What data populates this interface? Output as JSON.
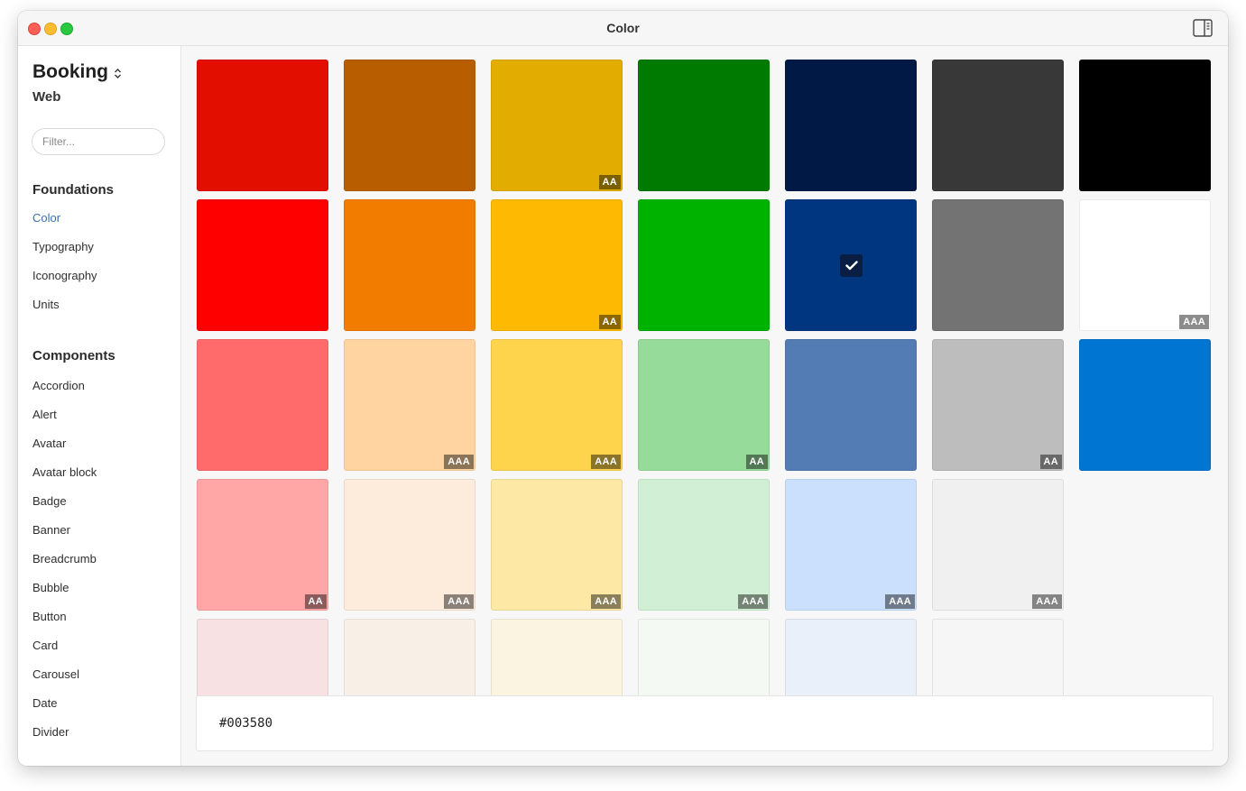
{
  "window": {
    "title": "Color",
    "sidebar_toggle_icon": "sidebar-right-icon"
  },
  "sidebar": {
    "project": "Booking",
    "project_icon": "chevron-up-down-icon",
    "platform": "Web",
    "filter_placeholder": "Filter...",
    "foundations_heading": "Foundations",
    "foundations": [
      "Color",
      "Typography",
      "Iconography",
      "Units"
    ],
    "active_item": "Color",
    "components_heading": "Components",
    "components": [
      "Accordion",
      "Alert",
      "Avatar",
      "Avatar block",
      "Badge",
      "Banner",
      "Breadcrumb",
      "Bubble",
      "Button",
      "Card",
      "Carousel",
      "Date",
      "Divider"
    ]
  },
  "swatches": [
    [
      {
        "color": "#e20e00",
        "badge": ""
      },
      {
        "color": "#b85e00",
        "badge": ""
      },
      {
        "color": "#e2ad00",
        "badge": "AA"
      },
      {
        "color": "#007a00",
        "badge": ""
      },
      {
        "color": "#001a45",
        "badge": ""
      },
      {
        "color": "#383838",
        "badge": ""
      },
      {
        "color": "#000000",
        "badge": ""
      }
    ],
    [
      {
        "color": "#ff0000",
        "badge": ""
      },
      {
        "color": "#f27c00",
        "badge": ""
      },
      {
        "color": "#feba02",
        "badge": "AA"
      },
      {
        "color": "#00b200",
        "badge": ""
      },
      {
        "color": "#003580",
        "badge": "",
        "selected": true
      },
      {
        "color": "#737373",
        "badge": ""
      },
      {
        "color": "#ffffff",
        "badge": "AAA"
      }
    ],
    [
      {
        "color": "#ff6b6b",
        "badge": ""
      },
      {
        "color": "#ffd4a1",
        "badge": "AAA"
      },
      {
        "color": "#fed44c",
        "badge": "AAA"
      },
      {
        "color": "#97db9b",
        "badge": "AA"
      },
      {
        "color": "#537bb4",
        "badge": ""
      },
      {
        "color": "#bdbdbd",
        "badge": "AA"
      },
      {
        "color": "#0075d1",
        "badge": ""
      }
    ],
    [
      {
        "color": "#ffa7a7",
        "badge": "AA"
      },
      {
        "color": "#fdebdc",
        "badge": "AAA"
      },
      {
        "color": "#fee8a5",
        "badge": "AAA"
      },
      {
        "color": "#d1efd4",
        "badge": "AAA"
      },
      {
        "color": "#cbe0fc",
        "badge": "AAA"
      },
      {
        "color": "#f0f0f0",
        "badge": "AAA"
      }
    ],
    [
      {
        "color": "#f7e1e2",
        "badge": ""
      },
      {
        "color": "#f8f0e6",
        "badge": ""
      },
      {
        "color": "#fbf4e0",
        "badge": ""
      },
      {
        "color": "#f4f9f4",
        "badge": ""
      },
      {
        "color": "#e9f0fa",
        "badge": ""
      },
      {
        "color": "#f6f6f6",
        "badge": ""
      }
    ]
  ],
  "selected_hex": "#003580",
  "selected_check_icon": "checkmark-icon"
}
